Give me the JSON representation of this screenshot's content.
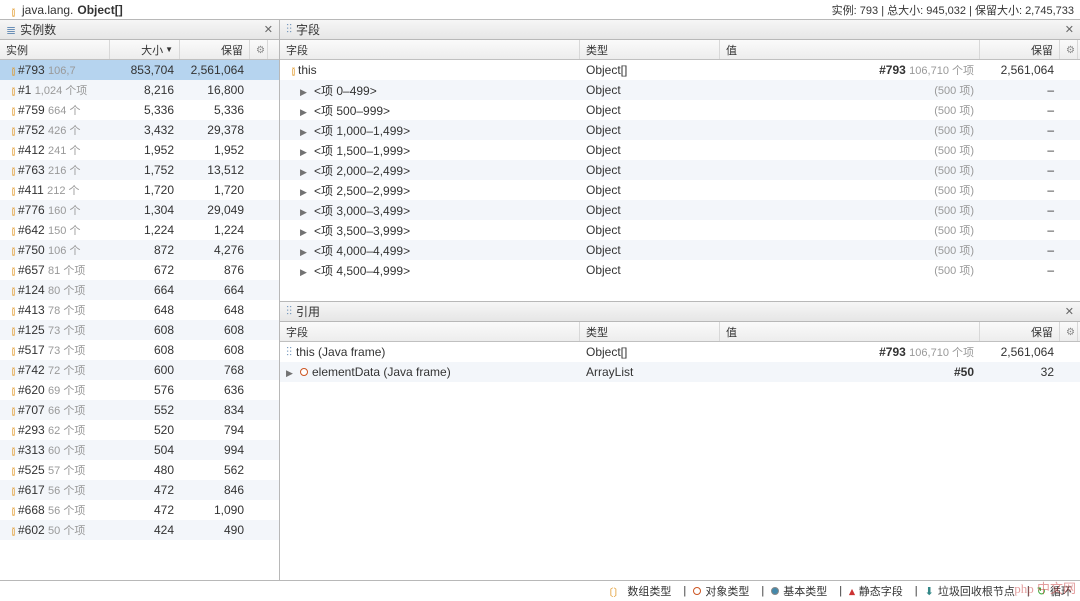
{
  "header": {
    "title_prefix": "java.lang.",
    "title_class": "Object[]",
    "stats": "实例: 793  |  总大小: 945,032  |  保留大小: 2,745,733"
  },
  "panels": {
    "instances_title": "实例数",
    "fields_title": "字段",
    "refs_title": "引用"
  },
  "left": {
    "cols": {
      "instance": "实例",
      "size": "大小",
      "retained": "保留"
    },
    "rows": [
      {
        "id": "#793",
        "meta": "106,7",
        "size": "853,704",
        "retained": "2,561,064",
        "sel": true
      },
      {
        "id": "#1",
        "meta": "1,024 个项",
        "size": "8,216",
        "retained": "16,800"
      },
      {
        "id": "#759",
        "meta": "664 个",
        "size": "5,336",
        "retained": "5,336"
      },
      {
        "id": "#752",
        "meta": "426 个",
        "size": "3,432",
        "retained": "29,378"
      },
      {
        "id": "#412",
        "meta": "241 个",
        "size": "1,952",
        "retained": "1,952"
      },
      {
        "id": "#763",
        "meta": "216 个",
        "size": "1,752",
        "retained": "13,512"
      },
      {
        "id": "#411",
        "meta": "212 个",
        "size": "1,720",
        "retained": "1,720"
      },
      {
        "id": "#776",
        "meta": "160 个",
        "size": "1,304",
        "retained": "29,049"
      },
      {
        "id": "#642",
        "meta": "150 个",
        "size": "1,224",
        "retained": "1,224"
      },
      {
        "id": "#750",
        "meta": "106 个",
        "size": "872",
        "retained": "4,276"
      },
      {
        "id": "#657",
        "meta": "81 个项",
        "size": "672",
        "retained": "876"
      },
      {
        "id": "#124",
        "meta": "80 个项",
        "size": "664",
        "retained": "664"
      },
      {
        "id": "#413",
        "meta": "78 个项",
        "size": "648",
        "retained": "648"
      },
      {
        "id": "#125",
        "meta": "73 个项",
        "size": "608",
        "retained": "608"
      },
      {
        "id": "#517",
        "meta": "73 个项",
        "size": "608",
        "retained": "608"
      },
      {
        "id": "#742",
        "meta": "72 个项",
        "size": "600",
        "retained": "768"
      },
      {
        "id": "#620",
        "meta": "69 个项",
        "size": "576",
        "retained": "636"
      },
      {
        "id": "#707",
        "meta": "66 个项",
        "size": "552",
        "retained": "834"
      },
      {
        "id": "#293",
        "meta": "62 个项",
        "size": "520",
        "retained": "794"
      },
      {
        "id": "#313",
        "meta": "60 个项",
        "size": "504",
        "retained": "994"
      },
      {
        "id": "#525",
        "meta": "57 个项",
        "size": "480",
        "retained": "562"
      },
      {
        "id": "#617",
        "meta": "56 个项",
        "size": "472",
        "retained": "846"
      },
      {
        "id": "#668",
        "meta": "56 个项",
        "size": "472",
        "retained": "1,090"
      },
      {
        "id": "#602",
        "meta": "50 个项",
        "size": "424",
        "retained": "490"
      }
    ]
  },
  "fields": {
    "cols": {
      "field": "字段",
      "type": "类型",
      "value": "值",
      "retained": "保留"
    },
    "rows": [
      {
        "label": "this",
        "type": "Object[]",
        "value_a": "#793",
        "value_b": "106,710 个项",
        "retained": "2,561,064",
        "leaf": true
      },
      {
        "label": "<项 0–499>",
        "type": "Object",
        "value_b": "(500 项)",
        "retained": "–"
      },
      {
        "label": "<项 500–999>",
        "type": "Object",
        "value_b": "(500 项)",
        "retained": "–"
      },
      {
        "label": "<项 1,000–1,499>",
        "type": "Object",
        "value_b": "(500 项)",
        "retained": "–"
      },
      {
        "label": "<项 1,500–1,999>",
        "type": "Object",
        "value_b": "(500 项)",
        "retained": "–"
      },
      {
        "label": "<项 2,000–2,499>",
        "type": "Object",
        "value_b": "(500 项)",
        "retained": "–"
      },
      {
        "label": "<项 2,500–2,999>",
        "type": "Object",
        "value_b": "(500 项)",
        "retained": "–"
      },
      {
        "label": "<项 3,000–3,499>",
        "type": "Object",
        "value_b": "(500 项)",
        "retained": "–"
      },
      {
        "label": "<项 3,500–3,999>",
        "type": "Object",
        "value_b": "(500 项)",
        "retained": "–"
      },
      {
        "label": "<项 4,000–4,499>",
        "type": "Object",
        "value_b": "(500 项)",
        "retained": "–"
      },
      {
        "label": "<项 4,500–4,999>",
        "type": "Object",
        "value_b": "(500 项)",
        "retained": "–"
      }
    ]
  },
  "refs": {
    "rows": [
      {
        "label": "this (Java frame)",
        "type": "Object[]",
        "value_a": "#793",
        "value_b": "106,710 个项",
        "retained": "2,561,064",
        "icon": "frame"
      },
      {
        "label": "elementData (Java frame)",
        "type": "ArrayList",
        "value_a": "#50",
        "value_b": "",
        "retained": "32",
        "icon": "obj",
        "expand": true
      }
    ]
  },
  "statusbar": {
    "array_type": "数组类型",
    "object_type": "对象类型",
    "prim_type": "基本类型",
    "static_field": "静态字段",
    "gc_root": "垃圾回收根节点",
    "cycle": "循环"
  },
  "watermark": "php 中文网"
}
